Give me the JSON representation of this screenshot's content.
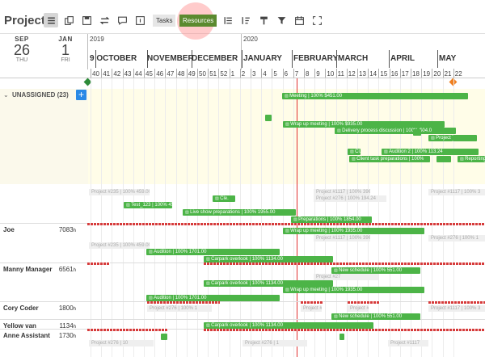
{
  "toolbar": {
    "title": "Project",
    "tab_tasks": "Tasks",
    "tab_resources": "Resources",
    "icons": [
      "hamburger-icon",
      "copy-icon",
      "save-icon",
      "swap-icon",
      "comment-icon",
      "info-icon",
      "outline-icon",
      "sort-icon",
      "paint-icon",
      "filter-icon",
      "calendar-icon",
      "fullscreen-icon"
    ]
  },
  "dates": {
    "start": {
      "month": "SEP",
      "day": "26",
      "weekday": "THU"
    },
    "end": {
      "month": "JAN",
      "day": "1",
      "weekday": "FRI"
    }
  },
  "timeline": {
    "years": [
      "2019",
      "2020"
    ],
    "months": [
      "9 OCTOBER",
      "NOVEMBER",
      "DECEMBER",
      "JANUARY",
      "FEBRUARY",
      "MARCH",
      "APRIL",
      "MAY"
    ],
    "weeks": [
      "40",
      "41",
      "42",
      "43",
      "44",
      "45",
      "46",
      "47",
      "48",
      "49",
      "50",
      "51",
      "52",
      "1",
      "2",
      "3",
      "4",
      "5",
      "6",
      "7",
      "8",
      "9",
      "10",
      "11",
      "12",
      "13",
      "14",
      "15",
      "16",
      "17",
      "18",
      "19",
      "20",
      "21",
      "22"
    ]
  },
  "unassigned": {
    "label": "UNASSIGNED (23)",
    "add": "+"
  },
  "rows": [
    {
      "name": "Joe",
      "hours": "7083",
      "unit": "h"
    },
    {
      "name": "Manny Manager",
      "hours": "6561",
      "unit": "h"
    },
    {
      "name": "Cory Coder",
      "hours": "1800",
      "unit": "h"
    },
    {
      "name": "Yellow van",
      "hours": "1134",
      "unit": "h"
    },
    {
      "name": "Anne Assistant",
      "hours": "1730",
      "unit": "h"
    }
  ],
  "bars": {
    "meeting": "Meeting | 100% $451.00",
    "wrapup1": "Wrap up meeting | 100% $935.00",
    "delivery": "Delivery process discussion | 100% $04.0",
    "project": "Project",
    "audition2": "Audition 2 | 100% 113.24",
    "cl": "Cl.",
    "client": "Client task preparations | 100%",
    "reporting": "Reporting",
    "pl": "Pl",
    "cle": "Cle.",
    "test": "Test_123 | 100% 459.00",
    "liveshow": "Live show preparations | 100% 1955.00",
    "prep": "Preparations | 100% 1854.00",
    "wrapup2": "Wrap up meeting | 100% 1935.00",
    "audition": "Audition | 100% 1701.00",
    "carpark": "Carpark overlook | 100% 1134.00",
    "newsched": "New schedule | 100% 551.00",
    "carpark2": "Carpark overlook | 100% 1134.00",
    "wrapup3": "Wrap up meeting | 100% 1935.00",
    "audition3": "Audition | 100% 1701.00",
    "newsched2": "New schedule | 100% 551.00",
    "carpark3": "Carpark overlook | 100% 1134.00"
  },
  "ghosts": {
    "g1": "Project #235 | 100% 459.00",
    "g2": "Project #1117 | 100% 396.00",
    "g3": "Project #276 | 100% 194.24",
    "g4": "Project #1117 | 100% 3",
    "g5": "Project #1117 | 100% 396.00",
    "g6": "Project #276 | 100% 1",
    "g7": "Project #235 | 100% 459.00",
    "g8": "Project #27",
    "g9": "Project #276 | 100% 1",
    "g10": "Project #276 | 10",
    "g11": "Project #1117",
    "g12": "Project #1117 | 100% 3",
    "g13": "Project #2",
    "g14": "Project #1",
    "g15": "Project #276 | 1"
  },
  "colors": {
    "accent": "#5b8a2f",
    "bar": "#4cb447",
    "today": "#e03030",
    "unassigned_bg": "#fffde8"
  }
}
